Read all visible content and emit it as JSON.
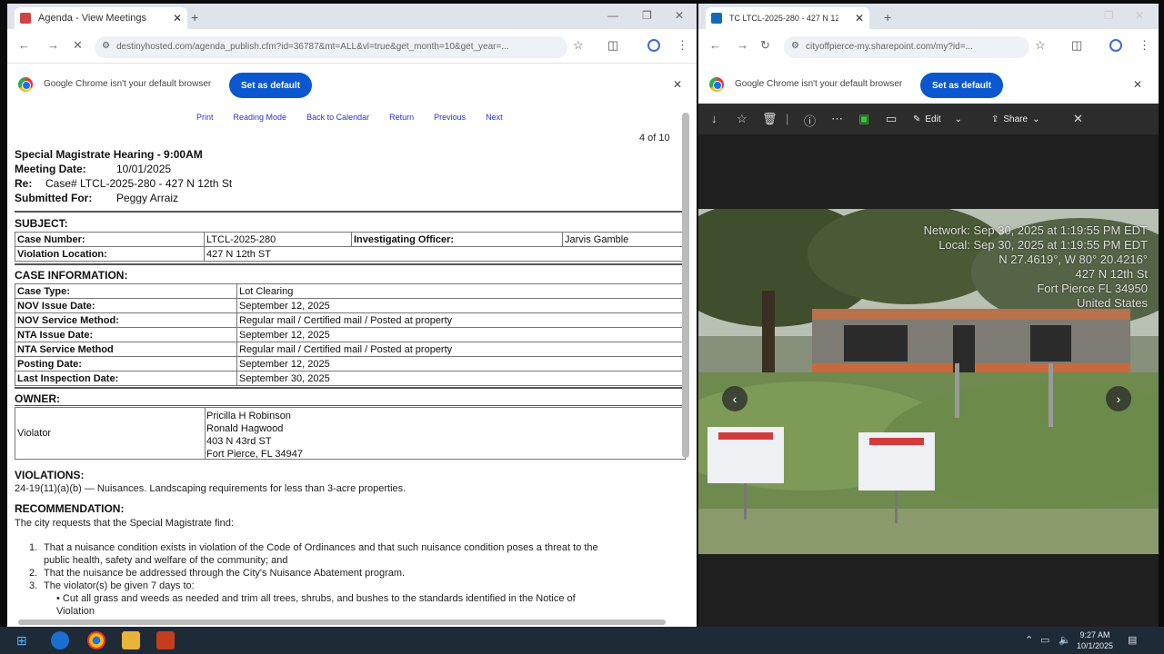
{
  "left_browser": {
    "tab_title": "Agenda - View Meetings",
    "url": "destinyhosted.com/agenda_publish.cfm?id=36787&mt=ALL&vl=true&get_month=10&get_year=...",
    "infobar_text": "Google Chrome isn't your default browser",
    "set_default_label": "Set as default"
  },
  "agenda": {
    "nav_links": [
      "Print",
      "Reading Mode",
      "Back to Calendar",
      "Return",
      "Previous",
      "Next"
    ],
    "page_info": "4 of 10",
    "title": "Special Magistrate Hearing - 9:00AM",
    "meeting_date_label": "Meeting Date:",
    "meeting_date": "10/01/2025",
    "re_label": "Re:",
    "re_value": "Case# LTCL-2025-280 - 427 N 12th St",
    "submitted_for_label": "Submitted For:",
    "submitted_for": "Peggy Arraiz",
    "subject_heading": "SUBJECT:",
    "subject": {
      "case_number_label": "Case Number:",
      "case_number": "LTCL-2025-280",
      "investigating_officer_label": "Investigating Officer:",
      "investigating_officer": "Jarvis Gamble",
      "violation_location_label": "Violation Location:",
      "violation_location": "427 N 12th ST"
    },
    "case_info_heading": "CASE INFORMATION:",
    "case_info": [
      {
        "label": "Case Type:",
        "value": "Lot Clearing"
      },
      {
        "label": "NOV Issue Date:",
        "value": "September 12, 2025"
      },
      {
        "label": "NOV Service Method:",
        "value": "Regular mail / Certified mail / Posted at property"
      },
      {
        "label": "NTA Issue Date:",
        "value": "September 12, 2025"
      },
      {
        "label": "NTA Service Method",
        "value": "Regular mail / Certified mail / Posted at property"
      },
      {
        "label": "Posting Date:",
        "value": "September 12, 2025"
      },
      {
        "label": "Last Inspection Date:",
        "value": "September 30, 2025"
      }
    ],
    "owner_heading": "OWNER:",
    "owner_label": "Violator",
    "owner_lines": [
      "Pricilla H Robinson",
      "Ronald Hagwood",
      "403 N 43rd ST",
      "Fort Pierce, FL 34947"
    ],
    "violations_heading": "VIOLATIONS:",
    "violation_text": "24-19(11)(a)(b) — Nuisances. Landscaping requirements for less than 3-acre properties.",
    "recommendation_heading": "RECOMMENDATION:",
    "recommendation_intro": "The city requests that the Special Magistrate find:",
    "recommendation_items": [
      {
        "num": "1.",
        "text": "That a nuisance condition exists in violation of the Code of Ordinances and that such nuisance condition poses a threat to the"
      },
      {
        "num": "",
        "text": "public health, safety and welfare of the community; and"
      },
      {
        "num": "2.",
        "text": "That the nuisance be addressed through the City's Nuisance Abatement program."
      },
      {
        "num": "3.",
        "text": "The violator(s) be given 7 days to:"
      }
    ],
    "sub_item": "Cut all grass and weeds as needed and trim all trees, shrubs, and bushes to the standards identified in the Notice of",
    "sub_item_cont": "Violation"
  },
  "right_browser": {
    "tab_title": "TC LTCL-2025-280 - 427 N 12...",
    "url": "cityoffpierce-my.sharepoint.com/my?id=...",
    "infobar_text": "Google Chrome isn't your default browser",
    "set_default_label": "Set as default",
    "edit_label": "Edit",
    "share_label": "Share"
  },
  "photo": {
    "geo_lines": [
      "Network: Sep 30, 2025 at 1:19:55 PM EDT",
      "Local: Sep 30, 2025 at 1:19:55 PM EDT",
      "N 27.4619°, W 80° 20.4216°",
      "427 N 12th St",
      "Fort Pierce FL 34950",
      "United States"
    ]
  },
  "taskbar": {
    "time": "9:27 AM",
    "date": "10/1/2025"
  }
}
